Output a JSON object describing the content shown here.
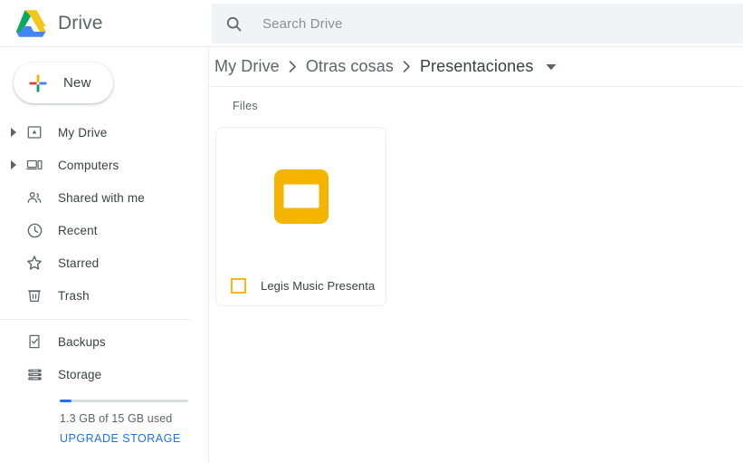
{
  "app": {
    "name": "Drive",
    "logo_icon": "google-drive-logo",
    "colors": {
      "drive_green": "#0da960",
      "drive_yellow": "#f5c518",
      "drive_blue": "#4285f4",
      "slides_yellow": "#F4B400",
      "link_blue": "#1a73e8",
      "search_bg": "#f1f3f4"
    }
  },
  "search": {
    "icon": "search-icon",
    "placeholder": "Search Drive",
    "value": ""
  },
  "sidebar": {
    "new_button": {
      "label": "New",
      "icon": "plus-icon"
    },
    "items": [
      {
        "label": "My Drive",
        "icon": "my-drive-icon",
        "expandable": true
      },
      {
        "label": "Computers",
        "icon": "computers-icon",
        "expandable": true
      },
      {
        "label": "Shared with me",
        "icon": "shared-with-me-icon",
        "expandable": false
      },
      {
        "label": "Recent",
        "icon": "clock-icon",
        "expandable": false
      },
      {
        "label": "Starred",
        "icon": "star-icon",
        "expandable": false
      },
      {
        "label": "Trash",
        "icon": "trash-icon",
        "expandable": false
      }
    ],
    "items_secondary": [
      {
        "label": "Backups",
        "icon": "backups-icon"
      },
      {
        "label": "Storage",
        "icon": "storage-icon"
      }
    ],
    "storage": {
      "used_percent": 9,
      "usage_text": "1.3 GB of 15 GB used",
      "upgrade_label": "UPGRADE STORAGE"
    }
  },
  "breadcrumb": {
    "separator": "›",
    "items": [
      {
        "label": "My Drive"
      },
      {
        "label": "Otras cosas"
      },
      {
        "label": "Presentaciones"
      }
    ],
    "caret_icon": "chevron-down-icon"
  },
  "main": {
    "section_label": "Files",
    "files": [
      {
        "name": "Legis Music Presentat...",
        "type_icon": "google-slides-icon"
      }
    ]
  }
}
